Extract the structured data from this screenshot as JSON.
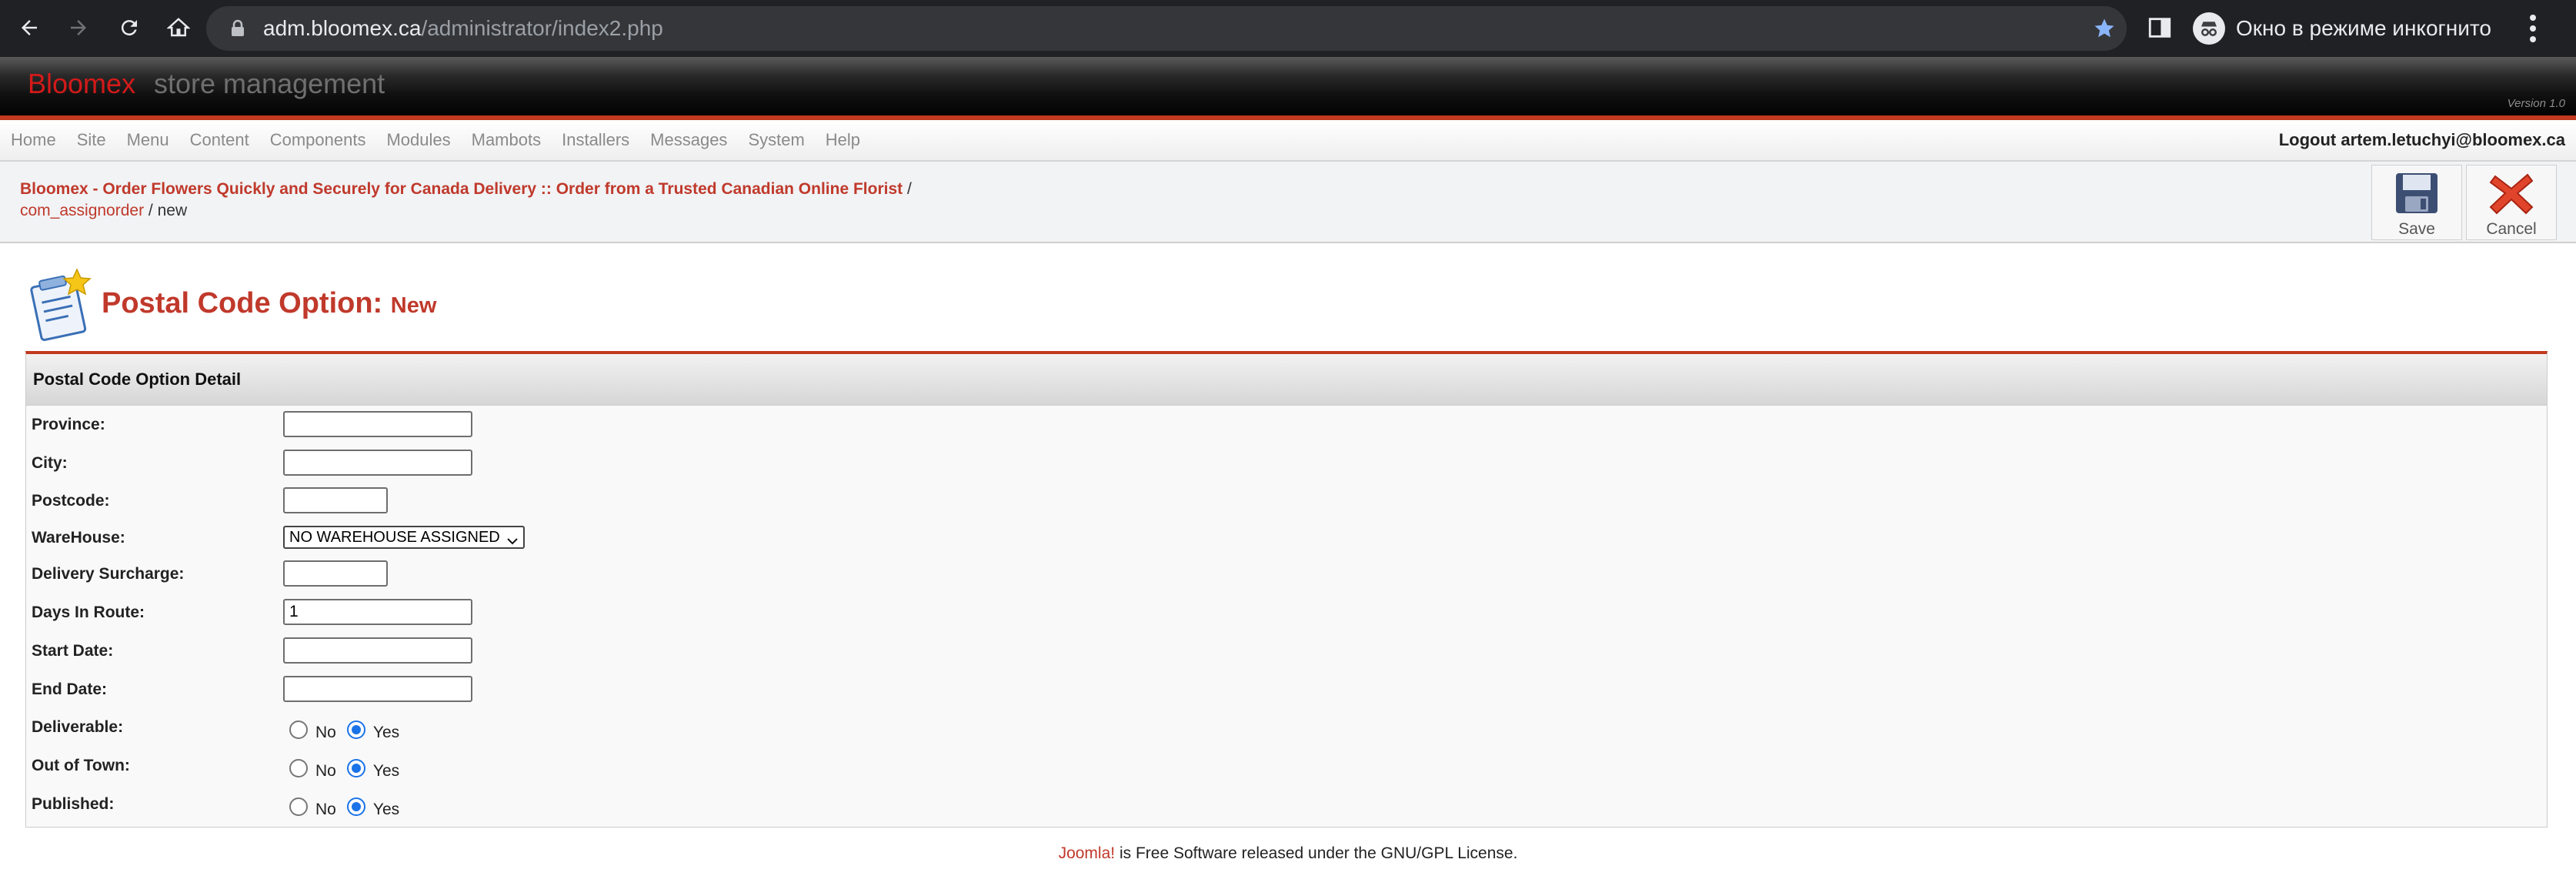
{
  "browser": {
    "url_host": "adm.bloomex.ca",
    "url_path": "/administrator/index2.php",
    "incognito_label": "Окно в режиме инкогнито"
  },
  "brand": {
    "name": "Bloomex",
    "subtitle": "store management",
    "version": "Version 1.0"
  },
  "menu": {
    "items": [
      "Home",
      "Site",
      "Menu",
      "Content",
      "Components",
      "Modules",
      "Mambots",
      "Installers",
      "Messages",
      "System",
      "Help"
    ],
    "logout": "Logout artem.letuchyi@bloomex.ca"
  },
  "pathway": {
    "site_link": "Bloomex - Order Flowers Quickly and Securely for Canada Delivery :: Order from a Trusted Canadian Online Florist",
    "sep1": " /",
    "component_link": "com_assignorder",
    "sep2": " / new"
  },
  "toolbar": {
    "save_label": "Save",
    "cancel_label": "Cancel"
  },
  "page": {
    "title": "Postal Code Option:",
    "subtitle": "New"
  },
  "form": {
    "panel_title": "Postal Code Option Detail",
    "province_label": "Province:",
    "province_value": "",
    "city_label": "City:",
    "city_value": "",
    "postcode_label": "Postcode:",
    "postcode_value": "",
    "warehouse_label": "WareHouse:",
    "warehouse_selected": "NO WAREHOUSE ASSIGNED",
    "surcharge_label": "Delivery Surcharge:",
    "surcharge_value": "",
    "days_label": "Days In Route:",
    "days_value": "1",
    "start_label": "Start Date:",
    "start_value": "",
    "end_label": "End Date:",
    "end_value": "",
    "deliverable_label": "Deliverable:",
    "deliverable_selected": "Yes",
    "outoftown_label": "Out of Town:",
    "outoftown_selected": "Yes",
    "published_label": "Published:",
    "published_selected": "Yes",
    "no_label": "No",
    "yes_label": "Yes"
  },
  "footer": {
    "joomla": "Joomla!",
    "text": " is Free Software released under the GNU/GPL License."
  },
  "colors": {
    "accent": "#c0392b",
    "chrome": "#202124",
    "radio_selected": "#1a73e8"
  },
  "icons": [
    "back-icon",
    "forward-icon",
    "reload-icon",
    "home-icon",
    "lock-icon",
    "star-icon",
    "side-panel-icon",
    "incognito-icon",
    "more-icon",
    "save-icon",
    "cancel-icon",
    "article-icon",
    "chevron-down-icon"
  ]
}
